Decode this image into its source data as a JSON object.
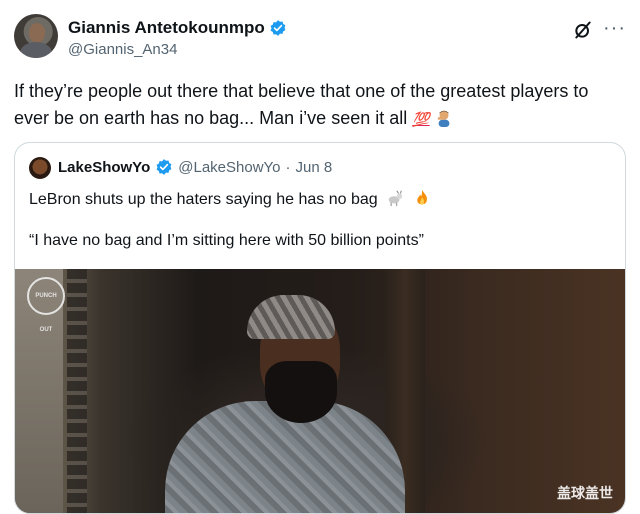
{
  "author": {
    "display_name": "Giannis Antetokounmpo",
    "handle": "@Giannis_An34"
  },
  "tweet": {
    "text_part1": "If they’re people out there that believe that one of the greatest players to ever be on earth has no bag...  Man i’ve seen it all ",
    "emoji_100": "💯"
  },
  "icons": {
    "verified": "verified-badge-icon",
    "grok": "grok-icon",
    "more": "more-icon"
  },
  "quote": {
    "display_name": "LakeShowYo",
    "handle": "@LakeShowYo",
    "dot": "·",
    "date": "Jun 8",
    "line1": "LeBron shuts up the haters saying he has no bag",
    "line2": "“I have no bag and I’m sitting here with 50 billion points”",
    "media_logo_text": "PUNCH OUT",
    "media_watermark": "盖球盖世"
  },
  "colors": {
    "verified_blue": "#1d9bf0",
    "secondary_text": "#536471",
    "border": "#cfd9de"
  }
}
